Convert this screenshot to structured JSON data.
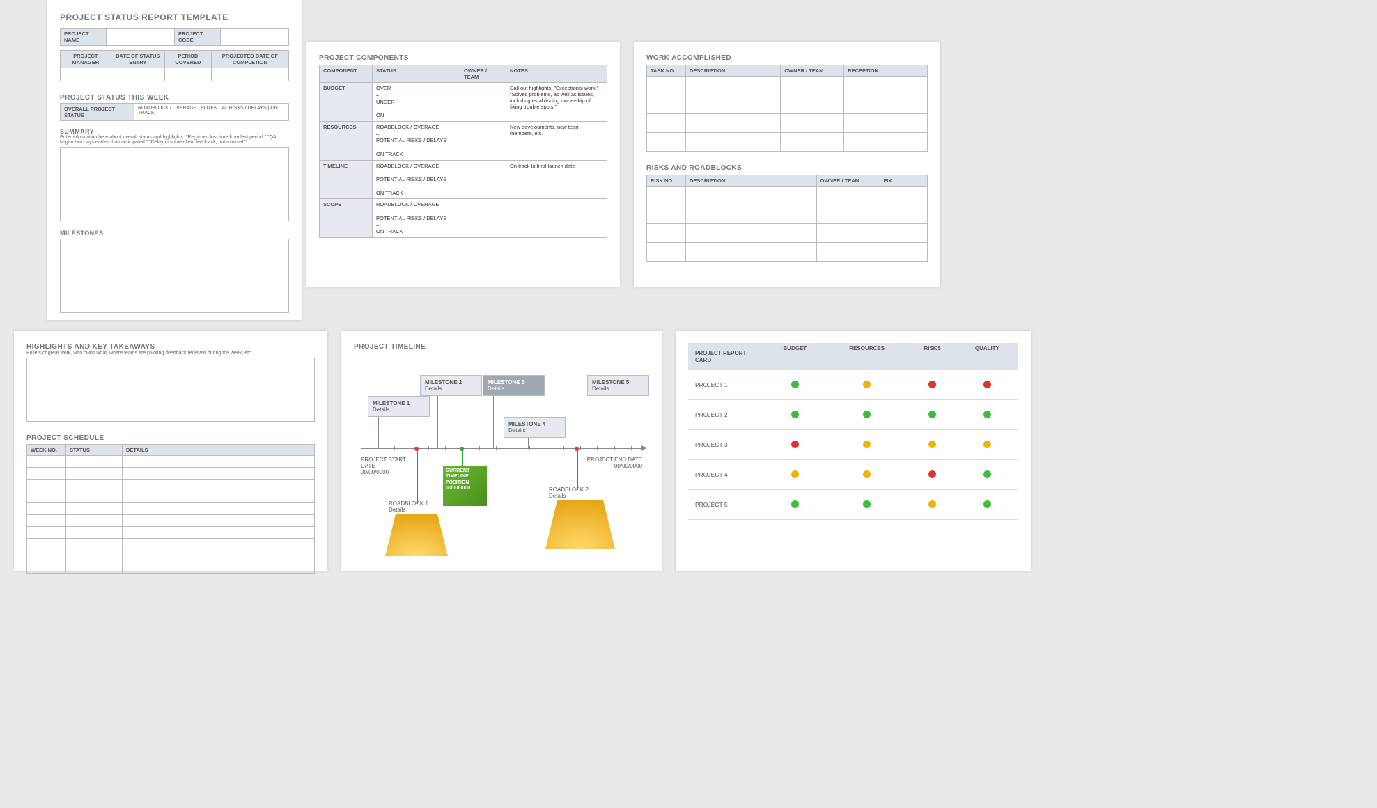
{
  "colors": {
    "green": "#3bbf3b",
    "yellow": "#f0b400",
    "red": "#e63030",
    "headerBg": "#dde3ea"
  },
  "p1": {
    "title": "PROJECT STATUS REPORT TEMPLATE",
    "info1": {
      "name": "PROJECT NAME",
      "code": "PROJECT CODE"
    },
    "info2": [
      "PROJECT MANAGER",
      "DATE OF STATUS ENTRY",
      "PERIOD COVERED",
      "PROJECTED DATE OF COMPLETION"
    ],
    "statusWeek": "PROJECT STATUS THIS WEEK",
    "statusRow": {
      "label": "OVERALL PROJECT STATUS",
      "opts": "ROADBLOCK / OVERAGE   |   POTENTIAL RISKS / DELAYS   |   ON TRACK"
    },
    "summaryTitle": "SUMMARY",
    "summaryHint": "Enter information here about overall status and highlights: \"Regained lost time from last period.\" \"QA began two days earlier than anticipated.\" \"Delay in some client feedback, but minimal.\"",
    "milestonesTitle": "MILESTONES"
  },
  "p2": {
    "title": "PROJECT COMPONENTS",
    "headers": [
      "COMPONENT",
      "STATUS",
      "OWNER / TEAM",
      "NOTES"
    ],
    "rows": [
      {
        "c": "BUDGET",
        "s": "OVER\n–\nUNDER\n–\nON",
        "n": "Call out highlights: \"Exceptional work.\" \"Solved problems, as well as issues, including establishing ownership of fixing trouble spots.\""
      },
      {
        "c": "RESOURCES",
        "s": "ROADBLOCK / OVERAGE\n–\nPOTENTIAL RISKS / DELAYS\n–\nON TRACK",
        "n": "New developments, new team members, etc."
      },
      {
        "c": "TIMELINE",
        "s": "ROADBLOCK / OVERAGE\n–\nPOTENTIAL RISKS / DELAYS\n–\nON TRACK",
        "n": "On track to final launch date"
      },
      {
        "c": "SCOPE",
        "s": "ROADBLOCK / OVERAGE\n–\nPOTENTIAL RISKS / DELAYS\n–\nON TRACK",
        "n": ""
      }
    ]
  },
  "p3": {
    "work": {
      "title": "WORK ACCOMPLISHED",
      "headers": [
        "TASK NO.",
        "DESCRIPTION",
        "OWNER / TEAM",
        "RECEPTION"
      ],
      "rows": 4
    },
    "risks": {
      "title": "RISKS AND ROADBLOCKS",
      "headers": [
        "RISK NO.",
        "DESCRIPTION",
        "OWNER / TEAM",
        "FIX"
      ],
      "rows": 4
    }
  },
  "p4": {
    "highlightsTitle": "HIGHLIGHTS AND KEY TAKEAWAYS",
    "highlightsHint": "Bullets of great work, who owns what, where teams are pivoting, feedback received during the week, etc.",
    "scheduleTitle": "PROJECT SCHEDULE",
    "scheduleHeaders": [
      "WEEK NO.",
      "STATUS",
      "DETAILS"
    ],
    "scheduleRows": 10
  },
  "p5": {
    "title": "PROJECT TIMELINE",
    "start": {
      "lbl": "PROJECT START DATE",
      "date": "00/00/0000"
    },
    "end": {
      "lbl": "PROJECT END DATE",
      "date": "00/00/0000"
    },
    "milestones": [
      {
        "t": "MILESTONE 1",
        "d": "Details"
      },
      {
        "t": "MILESTONE 2",
        "d": "Details"
      },
      {
        "t": "MILESTONE 3",
        "d": "Details"
      },
      {
        "t": "MILESTONE 4",
        "d": "Details"
      },
      {
        "t": "MILESTONE 5",
        "d": "Details"
      }
    ],
    "current": {
      "l1": "CURRENT",
      "l2": "TIMELINE",
      "l3": "POSITION",
      "l4": "00/00/0000"
    },
    "roadblocks": [
      {
        "t": "ROADBLOCK 1",
        "d": "Details"
      },
      {
        "t": "ROADBLOCK 2",
        "d": "Details"
      }
    ]
  },
  "p6": {
    "headers": [
      "PROJECT REPORT CARD",
      "BUDGET",
      "RESOURCES",
      "RISKS",
      "QUALITY"
    ],
    "rows": [
      {
        "label": "PROJECT 1",
        "cells": [
          "g",
          "y",
          "r",
          "r"
        ]
      },
      {
        "label": "PROJECT 2",
        "cells": [
          "g",
          "g",
          "g",
          "g"
        ]
      },
      {
        "label": "PROJECT 3",
        "cells": [
          "r",
          "y",
          "y",
          "y"
        ]
      },
      {
        "label": "PROJECT 4",
        "cells": [
          "y",
          "y",
          "r",
          "g"
        ]
      },
      {
        "label": "PROJECT 5",
        "cells": [
          "g",
          "g",
          "y",
          "g"
        ]
      }
    ]
  }
}
